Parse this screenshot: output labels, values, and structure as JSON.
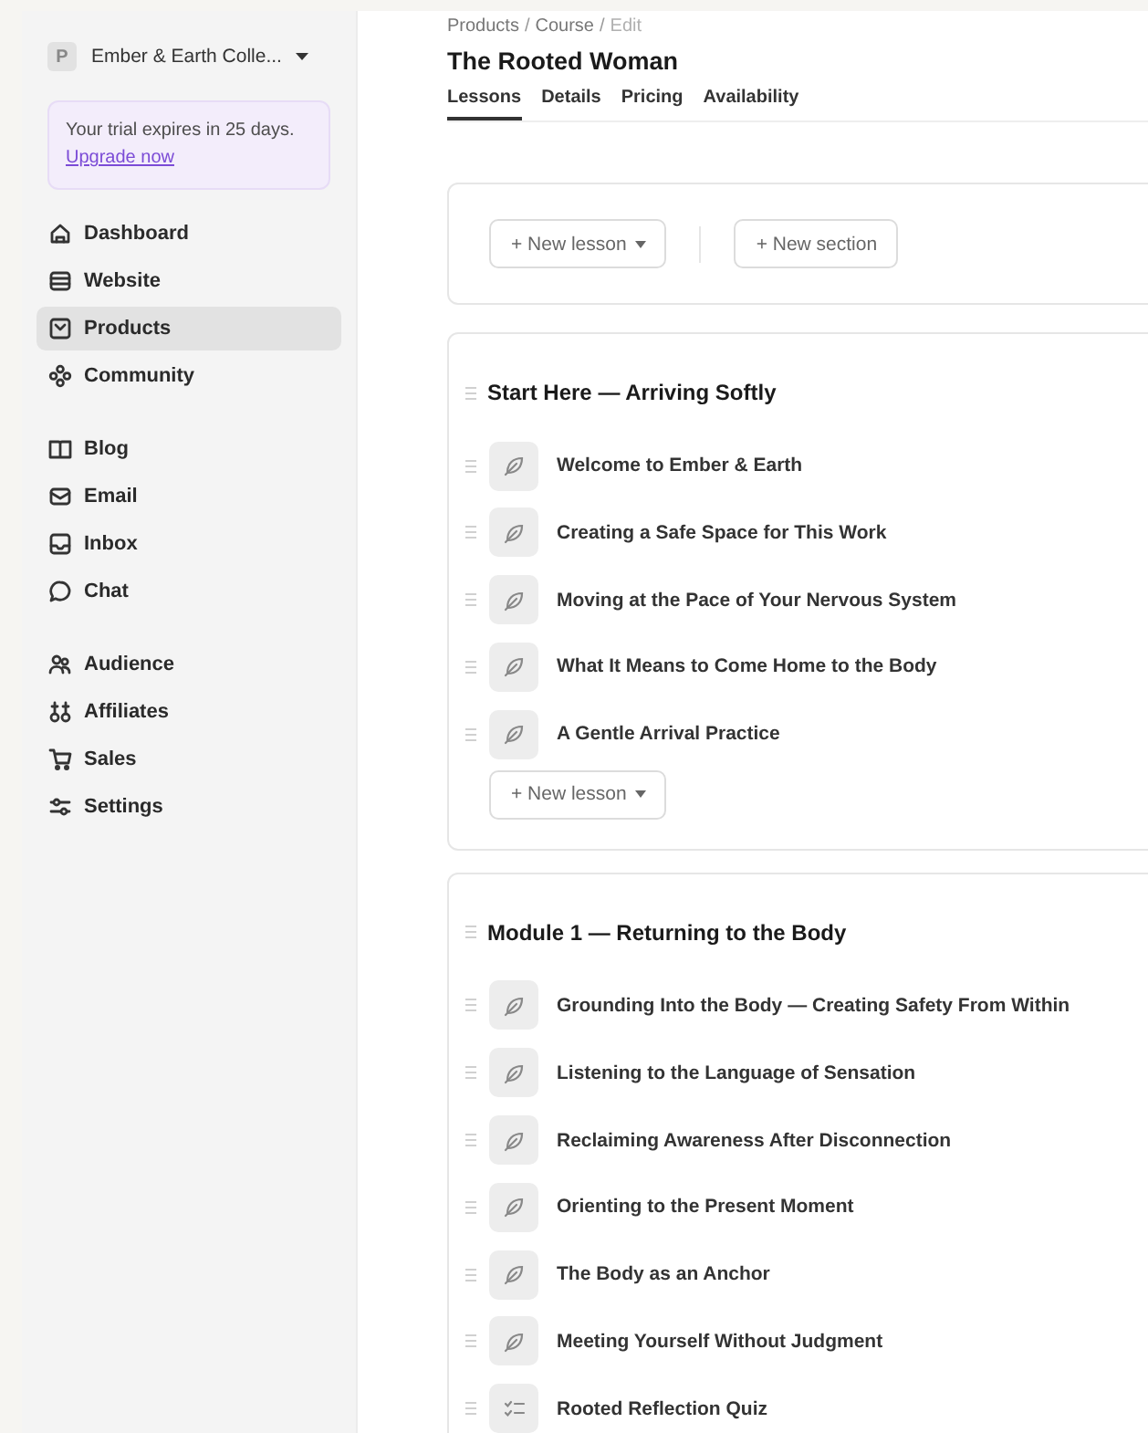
{
  "sidebar": {
    "workspace": {
      "initial": "P",
      "name": "Ember & Earth Colle..."
    },
    "trial": {
      "message": "Your trial expires in 25 days.",
      "link": "Upgrade now"
    },
    "groups": [
      [
        {
          "label": "Dashboard",
          "kind": "home",
          "selected": false
        },
        {
          "label": "Website",
          "kind": "website",
          "selected": false
        },
        {
          "label": "Products",
          "kind": "products",
          "selected": true
        },
        {
          "label": "Community",
          "kind": "community",
          "selected": false
        }
      ],
      [
        {
          "label": "Blog",
          "kind": "blog",
          "selected": false
        },
        {
          "label": "Email",
          "kind": "email",
          "selected": false
        },
        {
          "label": "Inbox",
          "kind": "inbox",
          "selected": false
        },
        {
          "label": "Chat",
          "kind": "chat",
          "selected": false
        }
      ],
      [
        {
          "label": "Audience",
          "kind": "audience",
          "selected": false
        },
        {
          "label": "Affiliates",
          "kind": "affiliates",
          "selected": false
        },
        {
          "label": "Sales",
          "kind": "sales",
          "selected": false
        },
        {
          "label": "Settings",
          "kind": "settings",
          "selected": false
        }
      ]
    ]
  },
  "header": {
    "breadcrumb": [
      "Products",
      "Course",
      "Edit"
    ],
    "breadcrumb_separator": "/",
    "title": "The Rooted Woman",
    "tabs": [
      {
        "label": "Lessons",
        "selected": true
      },
      {
        "label": "Details",
        "selected": false
      },
      {
        "label": "Pricing",
        "selected": false
      },
      {
        "label": "Availability",
        "selected": false
      }
    ]
  },
  "toolbar": {
    "new_lesson": "+ New lesson",
    "new_section": "+ New section"
  },
  "sections": [
    {
      "title": "Start Here — Arriving Softly",
      "lessons": [
        {
          "title": "Welcome to Ember & Earth",
          "kind": "lesson"
        },
        {
          "title": "Creating a Safe Space for This Work",
          "kind": "lesson"
        },
        {
          "title": "Moving at the Pace of Your Nervous System",
          "kind": "lesson"
        },
        {
          "title": "What It Means to Come Home to the Body",
          "kind": "lesson"
        },
        {
          "title": "A Gentle Arrival Practice",
          "kind": "lesson"
        }
      ],
      "add_button": "+ New lesson"
    },
    {
      "title": "Module 1 — Returning to the Body",
      "lessons": [
        {
          "title": "Grounding Into the Body — Creating Safety From Within",
          "kind": "lesson"
        },
        {
          "title": "Listening to the Language of Sensation",
          "kind": "lesson"
        },
        {
          "title": "Reclaiming Awareness After Disconnection",
          "kind": "lesson"
        },
        {
          "title": "Orienting to the Present Moment",
          "kind": "lesson"
        },
        {
          "title": "The Body as an Anchor",
          "kind": "lesson"
        },
        {
          "title": "Meeting Yourself Without Judgment",
          "kind": "lesson"
        },
        {
          "title": "Rooted Reflection Quiz",
          "kind": "quiz"
        }
      ]
    }
  ]
}
